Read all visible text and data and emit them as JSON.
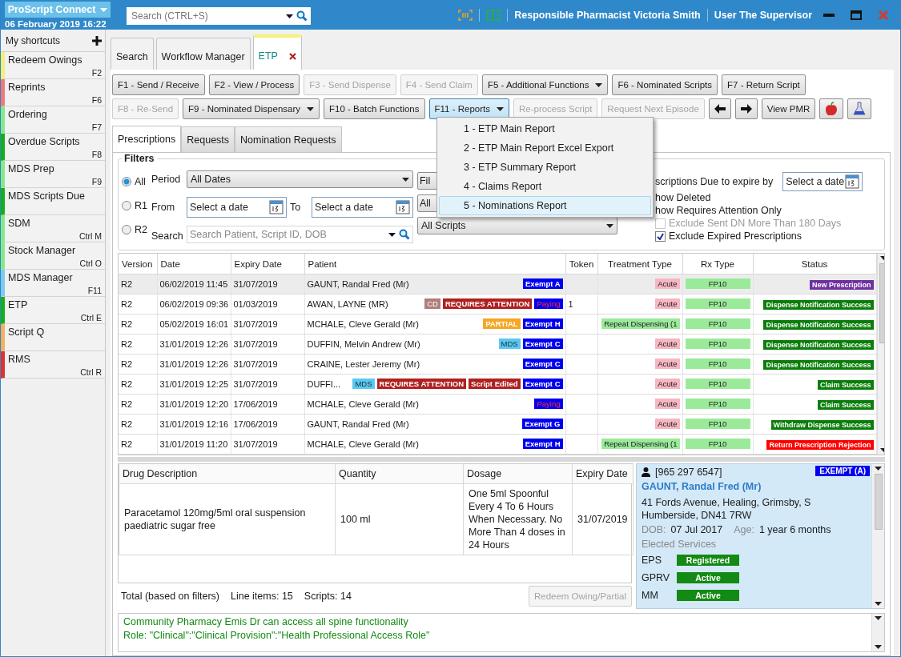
{
  "app": {
    "title": "ProScript Connect",
    "datetime": "06 February 2019 16:22"
  },
  "search": {
    "placeholder": "Search (CTRL+S)"
  },
  "header": {
    "pharmacist_label": "Responsible Pharmacist",
    "pharmacist": "Victoria Smith",
    "user_label": "User",
    "user": "The Supervisor"
  },
  "sidebar": {
    "title": "My shortcuts",
    "items": [
      {
        "label": "Redeem Owings",
        "key": "F2",
        "color": "#f5ef78"
      },
      {
        "label": "Reprints",
        "key": "F6",
        "color": "#f07a7a"
      },
      {
        "label": "Ordering",
        "key": "F7",
        "color": "#86e886"
      },
      {
        "label": "Overdue Scripts",
        "key": "F8",
        "color": "#16b016"
      },
      {
        "label": "MDS Prep",
        "key": "F9",
        "color": "#86e886"
      },
      {
        "label": "MDS Scripts Due",
        "color": "#16b016"
      },
      {
        "label": "SDM",
        "key": "Ctrl M",
        "color": "#86e886"
      },
      {
        "label": "Stock Manager",
        "key": "Ctrl O",
        "color": "#86e886"
      },
      {
        "label": "MDS Manager",
        "key": "F11",
        "color": "#7fc8f0"
      },
      {
        "label": "ETP",
        "key": "Ctrl E",
        "color": "#16b016"
      },
      {
        "label": "Script Q",
        "color": "#f5b060"
      },
      {
        "label": "RMS",
        "key": "Ctrl R",
        "color": "#e03030"
      }
    ]
  },
  "tabs": [
    {
      "label": "Search",
      "selected": false,
      "closable": false
    },
    {
      "label": "Workflow Manager",
      "selected": false,
      "closable": false
    },
    {
      "label": "ETP",
      "selected": true,
      "closable": true
    }
  ],
  "toolbar": [
    [
      {
        "kind": "button",
        "label": "F1 - Send / Receive",
        "disabled": false,
        "open": false
      },
      {
        "kind": "button",
        "label": "F2 - View / Process",
        "disabled": false,
        "open": false
      },
      {
        "kind": "button",
        "label": "F3 - Send Dispense",
        "disabled": true,
        "open": false
      },
      {
        "kind": "button",
        "label": "F4 - Send Claim",
        "disabled": true,
        "open": false
      },
      {
        "kind": "dropdown",
        "label": "F5 - Additional Functions",
        "disabled": false,
        "open": false
      },
      {
        "kind": "button",
        "label": "F6 - Nominated Scripts",
        "disabled": false,
        "open": false
      },
      {
        "kind": "button",
        "label": "F7 - Return Script",
        "disabled": false,
        "open": false
      }
    ],
    [
      {
        "kind": "button",
        "label": "F8 - Re-Send",
        "disabled": true,
        "open": false
      },
      {
        "kind": "dropdown",
        "label": "F9 - Nominated Dispensary",
        "disabled": false,
        "open": false
      },
      {
        "kind": "button",
        "label": "F10 - Batch Functions",
        "disabled": false,
        "open": false
      },
      {
        "kind": "dropdown",
        "label": "F11 - Reports",
        "disabled": false,
        "open": true
      },
      {
        "kind": "button",
        "label": "Re-process Script",
        "disabled": true,
        "open": false
      },
      {
        "kind": "button",
        "label": "Request Next Episode",
        "disabled": true,
        "open": false
      },
      {
        "kind": "back",
        "disabled": false,
        "open": false
      },
      {
        "kind": "forward",
        "disabled": false,
        "open": false
      },
      {
        "kind": "button",
        "label": "View PMR",
        "disabled": false,
        "open": false
      },
      {
        "kind": "apple",
        "disabled": false,
        "open": false
      },
      {
        "kind": "flask",
        "disabled": false,
        "open": false
      }
    ]
  ],
  "reports_menu": [
    {
      "label": "1 - ETP Main Report",
      "selected": false
    },
    {
      "label": "2 - ETP Main Report Excel Export",
      "selected": false
    },
    {
      "label": "3 - ETP Summary Report",
      "selected": false
    },
    {
      "label": "4 - Claims Report",
      "selected": false
    },
    {
      "label": "5 - Nominations Report",
      "selected": true
    }
  ],
  "subtabs": [
    {
      "label": "Prescriptions",
      "selected": true
    },
    {
      "label": "Requests",
      "selected": false
    },
    {
      "label": "Nomination Requests",
      "selected": false
    }
  ],
  "filters": {
    "title": "Filters",
    "radios": [
      {
        "label": "All",
        "selected": true
      },
      {
        "label": "R1",
        "selected": false
      },
      {
        "label": "R2",
        "selected": false
      }
    ],
    "period_label": "Period",
    "period": "All Dates",
    "from_label": "From",
    "from_placeholder": "Select a date",
    "to_label": "To",
    "to_placeholder": "Select a date",
    "search_label": "Search",
    "search_placeholder": "Search Patient, Script ID, DOB",
    "partial_button": "Fil",
    "partial_select": "All",
    "scripts": "All Scripts",
    "expire_label": "scriptions Due to expire by",
    "expire_placeholder": "Select a date",
    "partial_options": [
      "how Deleted",
      "how Requires Attention Only"
    ],
    "checkboxes": [
      {
        "label": "Exclude Sent DN More Than 180 Days",
        "checked": false,
        "disabled": true
      },
      {
        "label": "Exclude Expired Prescriptions",
        "checked": true,
        "disabled": false
      }
    ]
  },
  "table": {
    "columns": [
      "Version",
      "Date",
      "Expiry Date",
      "Patient",
      "Token",
      "Treatment Type",
      "Rx Type",
      "Status"
    ],
    "rows": [
      {
        "selected": true,
        "version": "R2",
        "date": "06/02/2019 11:45",
        "expiry": "31/07/2019",
        "patient": "GAUNT, Randal Fred (Mr)",
        "tags": [
          {
            "text": "Exempt A",
            "kind": "exempt"
          }
        ],
        "token": "",
        "treatment": {
          "text": "Acute",
          "kind": "acute"
        },
        "rx": "FP10",
        "status": {
          "text": "New Prescription",
          "color": "#7030a0"
        }
      },
      {
        "selected": false,
        "version": "R2",
        "date": "06/02/2019 09:36",
        "expiry": "01/03/2019",
        "patient": "AWAN, LAYNE (MR)",
        "tags": [
          {
            "text": "CD",
            "kind": "cd"
          },
          {
            "text": "REQUIRES ATTENTION",
            "kind": "attention"
          },
          {
            "text": "Paying",
            "kind": "paying"
          }
        ],
        "token": "1",
        "treatment": {
          "text": "Acute",
          "kind": "acute"
        },
        "rx": "FP10",
        "status": {
          "text": "Dispense Notification Success",
          "color": "#0a7d0a"
        }
      },
      {
        "selected": false,
        "version": "R2",
        "date": "05/02/2019 16:01",
        "expiry": "31/07/2019",
        "patient": "MCHALE, Cleve Gerald (Mr)",
        "tags": [
          {
            "text": "PARTIAL",
            "kind": "partial"
          },
          {
            "text": "Exempt H",
            "kind": "exempt"
          }
        ],
        "token": "",
        "treatment": {
          "text": "Repeat Dispensing  (1",
          "kind": "repeat"
        },
        "rx": "FP10",
        "status": {
          "text": "Dispense Notification Success",
          "color": "#0a7d0a"
        }
      },
      {
        "selected": false,
        "version": "R2",
        "date": "31/01/2019 12:26",
        "expiry": "31/07/2019",
        "patient": "DUFFIN, Melvin Andrew (Mr)",
        "tags": [
          {
            "text": "MDS",
            "kind": "mds"
          },
          {
            "text": "Exempt C",
            "kind": "exempt"
          }
        ],
        "token": "",
        "treatment": {
          "text": "Acute",
          "kind": "acute"
        },
        "rx": "FP10",
        "status": {
          "text": "Dispense Notification Success",
          "color": "#0a7d0a"
        }
      },
      {
        "selected": false,
        "version": "R2",
        "date": "31/01/2019 12:26",
        "expiry": "31/07/2019",
        "patient": "CRAINE, Lester Jeremy (Mr)",
        "tags": [
          {
            "text": "Exempt C",
            "kind": "exempt"
          }
        ],
        "token": "",
        "treatment": {
          "text": "Acute",
          "kind": "acute"
        },
        "rx": "FP10",
        "status": {
          "text": "Dispense Notification Success",
          "color": "#0a7d0a"
        }
      },
      {
        "selected": false,
        "version": "R2",
        "date": "31/01/2019 12:25",
        "expiry": "31/07/2019",
        "patient": "DUFFI...",
        "tags": [
          {
            "text": "MDS",
            "kind": "mds"
          },
          {
            "text": "REQUIRES ATTENTION",
            "kind": "attention"
          },
          {
            "text": "Script Edited",
            "kind": "edited"
          },
          {
            "text": "Exempt C",
            "kind": "exempt"
          }
        ],
        "token": "",
        "treatment": {
          "text": "Acute",
          "kind": "acute"
        },
        "rx": "FP10",
        "status": {
          "text": "Claim Success",
          "color": "#0a7d0a"
        }
      },
      {
        "selected": false,
        "version": "R2",
        "date": "31/01/2019 12:20",
        "expiry": "17/06/2019",
        "patient": "MCHALE, Cleve Gerald (Mr)",
        "tags": [
          {
            "text": "Paying",
            "kind": "paying"
          }
        ],
        "token": "",
        "treatment": {
          "text": "Acute",
          "kind": "acute"
        },
        "rx": "FP10",
        "status": {
          "text": "Claim Success",
          "color": "#0a7d0a"
        }
      },
      {
        "selected": false,
        "version": "R2",
        "date": "31/01/2019 12:16",
        "expiry": "17/06/2019",
        "patient": "GAUNT, Randal Fred (Mr)",
        "tags": [
          {
            "text": "Exempt G",
            "kind": "exempt"
          }
        ],
        "token": "",
        "treatment": {
          "text": "Acute",
          "kind": "acute"
        },
        "rx": "FP10",
        "status": {
          "text": "Withdraw Dispense Success",
          "color": "#0a7d0a"
        }
      },
      {
        "selected": false,
        "version": "R2",
        "date": "31/01/2019 11:20",
        "expiry": "31/07/2019",
        "patient": "MCHALE, Cleve Gerald (Mr)",
        "tags": [
          {
            "text": "Exempt H",
            "kind": "exempt"
          }
        ],
        "token": "",
        "treatment": {
          "text": "Repeat Dispensing  (1",
          "kind": "repeat"
        },
        "rx": "FP10",
        "status": {
          "text": "Return Prescription Rejection",
          "color": "#ff0000"
        }
      }
    ]
  },
  "drugs": {
    "columns": [
      "Drug Description",
      "Quantity",
      "Dosage",
      "Expiry Date"
    ],
    "rows": [
      {
        "description": "Paracetamol 120mg/5ml oral suspension paediatric sugar free",
        "quantity": "100 ml",
        "dosage": "One 5ml Spoonful Every 4 To 6 Hours When Necessary.  No More Than 4 doses in 24 Hours",
        "expiry": "31/07/2019"
      }
    ]
  },
  "totals": {
    "label": "Total (based on filters)",
    "line_items": "Line items: 15",
    "scripts": "Scripts: 14",
    "button": "Redeem Owing/Partial",
    "button_disabled": true
  },
  "patient": {
    "nhs": "[965 297 6547]",
    "badge": "EXEMPT (A)",
    "name": "GAUNT, Randal Fred (Mr)",
    "address": [
      "41 Fords Avenue, Healing, Grimsby, S",
      "Humberside, DN41 7RW"
    ],
    "dob_label": "DOB:",
    "dob": "07 Jul 2017",
    "age_label": "Age:",
    "age": "1 year 6 months",
    "services_title": "Elected Services",
    "services": [
      {
        "name": "EPS",
        "status": "Registered"
      },
      {
        "name": "GPRV",
        "status": "Active"
      },
      {
        "name": "MM",
        "status": "Active"
      }
    ]
  },
  "messages": [
    "Community Pharmacy Emis Dr can access all spine functionality",
    "Role: \"Clinical\":\"Clinical Provision\":\"Health Professional Access Role\""
  ]
}
